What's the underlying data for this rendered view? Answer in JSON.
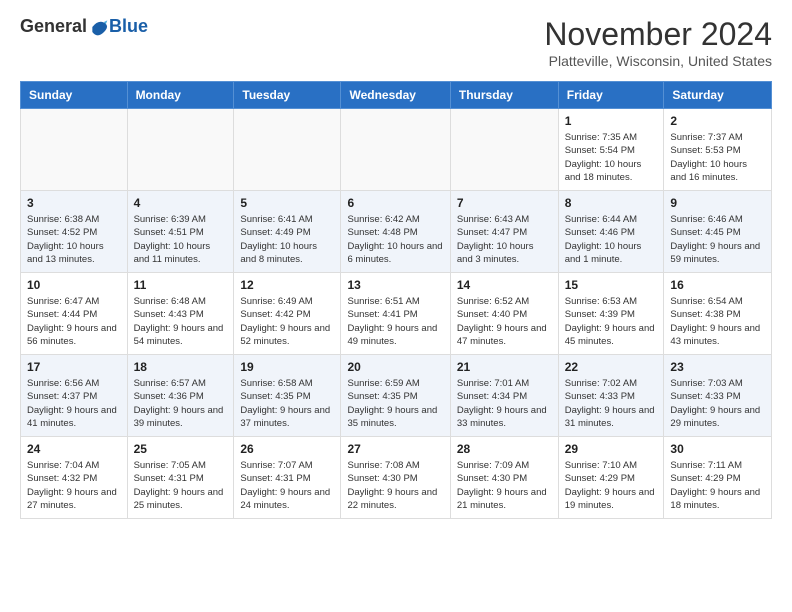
{
  "logo": {
    "general": "General",
    "blue": "Blue"
  },
  "title": "November 2024",
  "location": "Platteville, Wisconsin, United States",
  "days_of_week": [
    "Sunday",
    "Monday",
    "Tuesday",
    "Wednesday",
    "Thursday",
    "Friday",
    "Saturday"
  ],
  "weeks": [
    [
      {
        "day": "",
        "info": ""
      },
      {
        "day": "",
        "info": ""
      },
      {
        "day": "",
        "info": ""
      },
      {
        "day": "",
        "info": ""
      },
      {
        "day": "",
        "info": ""
      },
      {
        "day": "1",
        "info": "Sunrise: 7:35 AM\nSunset: 5:54 PM\nDaylight: 10 hours and 18 minutes."
      },
      {
        "day": "2",
        "info": "Sunrise: 7:37 AM\nSunset: 5:53 PM\nDaylight: 10 hours and 16 minutes."
      }
    ],
    [
      {
        "day": "3",
        "info": "Sunrise: 6:38 AM\nSunset: 4:52 PM\nDaylight: 10 hours and 13 minutes."
      },
      {
        "day": "4",
        "info": "Sunrise: 6:39 AM\nSunset: 4:51 PM\nDaylight: 10 hours and 11 minutes."
      },
      {
        "day": "5",
        "info": "Sunrise: 6:41 AM\nSunset: 4:49 PM\nDaylight: 10 hours and 8 minutes."
      },
      {
        "day": "6",
        "info": "Sunrise: 6:42 AM\nSunset: 4:48 PM\nDaylight: 10 hours and 6 minutes."
      },
      {
        "day": "7",
        "info": "Sunrise: 6:43 AM\nSunset: 4:47 PM\nDaylight: 10 hours and 3 minutes."
      },
      {
        "day": "8",
        "info": "Sunrise: 6:44 AM\nSunset: 4:46 PM\nDaylight: 10 hours and 1 minute."
      },
      {
        "day": "9",
        "info": "Sunrise: 6:46 AM\nSunset: 4:45 PM\nDaylight: 9 hours and 59 minutes."
      }
    ],
    [
      {
        "day": "10",
        "info": "Sunrise: 6:47 AM\nSunset: 4:44 PM\nDaylight: 9 hours and 56 minutes."
      },
      {
        "day": "11",
        "info": "Sunrise: 6:48 AM\nSunset: 4:43 PM\nDaylight: 9 hours and 54 minutes."
      },
      {
        "day": "12",
        "info": "Sunrise: 6:49 AM\nSunset: 4:42 PM\nDaylight: 9 hours and 52 minutes."
      },
      {
        "day": "13",
        "info": "Sunrise: 6:51 AM\nSunset: 4:41 PM\nDaylight: 9 hours and 49 minutes."
      },
      {
        "day": "14",
        "info": "Sunrise: 6:52 AM\nSunset: 4:40 PM\nDaylight: 9 hours and 47 minutes."
      },
      {
        "day": "15",
        "info": "Sunrise: 6:53 AM\nSunset: 4:39 PM\nDaylight: 9 hours and 45 minutes."
      },
      {
        "day": "16",
        "info": "Sunrise: 6:54 AM\nSunset: 4:38 PM\nDaylight: 9 hours and 43 minutes."
      }
    ],
    [
      {
        "day": "17",
        "info": "Sunrise: 6:56 AM\nSunset: 4:37 PM\nDaylight: 9 hours and 41 minutes."
      },
      {
        "day": "18",
        "info": "Sunrise: 6:57 AM\nSunset: 4:36 PM\nDaylight: 9 hours and 39 minutes."
      },
      {
        "day": "19",
        "info": "Sunrise: 6:58 AM\nSunset: 4:35 PM\nDaylight: 9 hours and 37 minutes."
      },
      {
        "day": "20",
        "info": "Sunrise: 6:59 AM\nSunset: 4:35 PM\nDaylight: 9 hours and 35 minutes."
      },
      {
        "day": "21",
        "info": "Sunrise: 7:01 AM\nSunset: 4:34 PM\nDaylight: 9 hours and 33 minutes."
      },
      {
        "day": "22",
        "info": "Sunrise: 7:02 AM\nSunset: 4:33 PM\nDaylight: 9 hours and 31 minutes."
      },
      {
        "day": "23",
        "info": "Sunrise: 7:03 AM\nSunset: 4:33 PM\nDaylight: 9 hours and 29 minutes."
      }
    ],
    [
      {
        "day": "24",
        "info": "Sunrise: 7:04 AM\nSunset: 4:32 PM\nDaylight: 9 hours and 27 minutes."
      },
      {
        "day": "25",
        "info": "Sunrise: 7:05 AM\nSunset: 4:31 PM\nDaylight: 9 hours and 25 minutes."
      },
      {
        "day": "26",
        "info": "Sunrise: 7:07 AM\nSunset: 4:31 PM\nDaylight: 9 hours and 24 minutes."
      },
      {
        "day": "27",
        "info": "Sunrise: 7:08 AM\nSunset: 4:30 PM\nDaylight: 9 hours and 22 minutes."
      },
      {
        "day": "28",
        "info": "Sunrise: 7:09 AM\nSunset: 4:30 PM\nDaylight: 9 hours and 21 minutes."
      },
      {
        "day": "29",
        "info": "Sunrise: 7:10 AM\nSunset: 4:29 PM\nDaylight: 9 hours and 19 minutes."
      },
      {
        "day": "30",
        "info": "Sunrise: 7:11 AM\nSunset: 4:29 PM\nDaylight: 9 hours and 18 minutes."
      }
    ]
  ]
}
